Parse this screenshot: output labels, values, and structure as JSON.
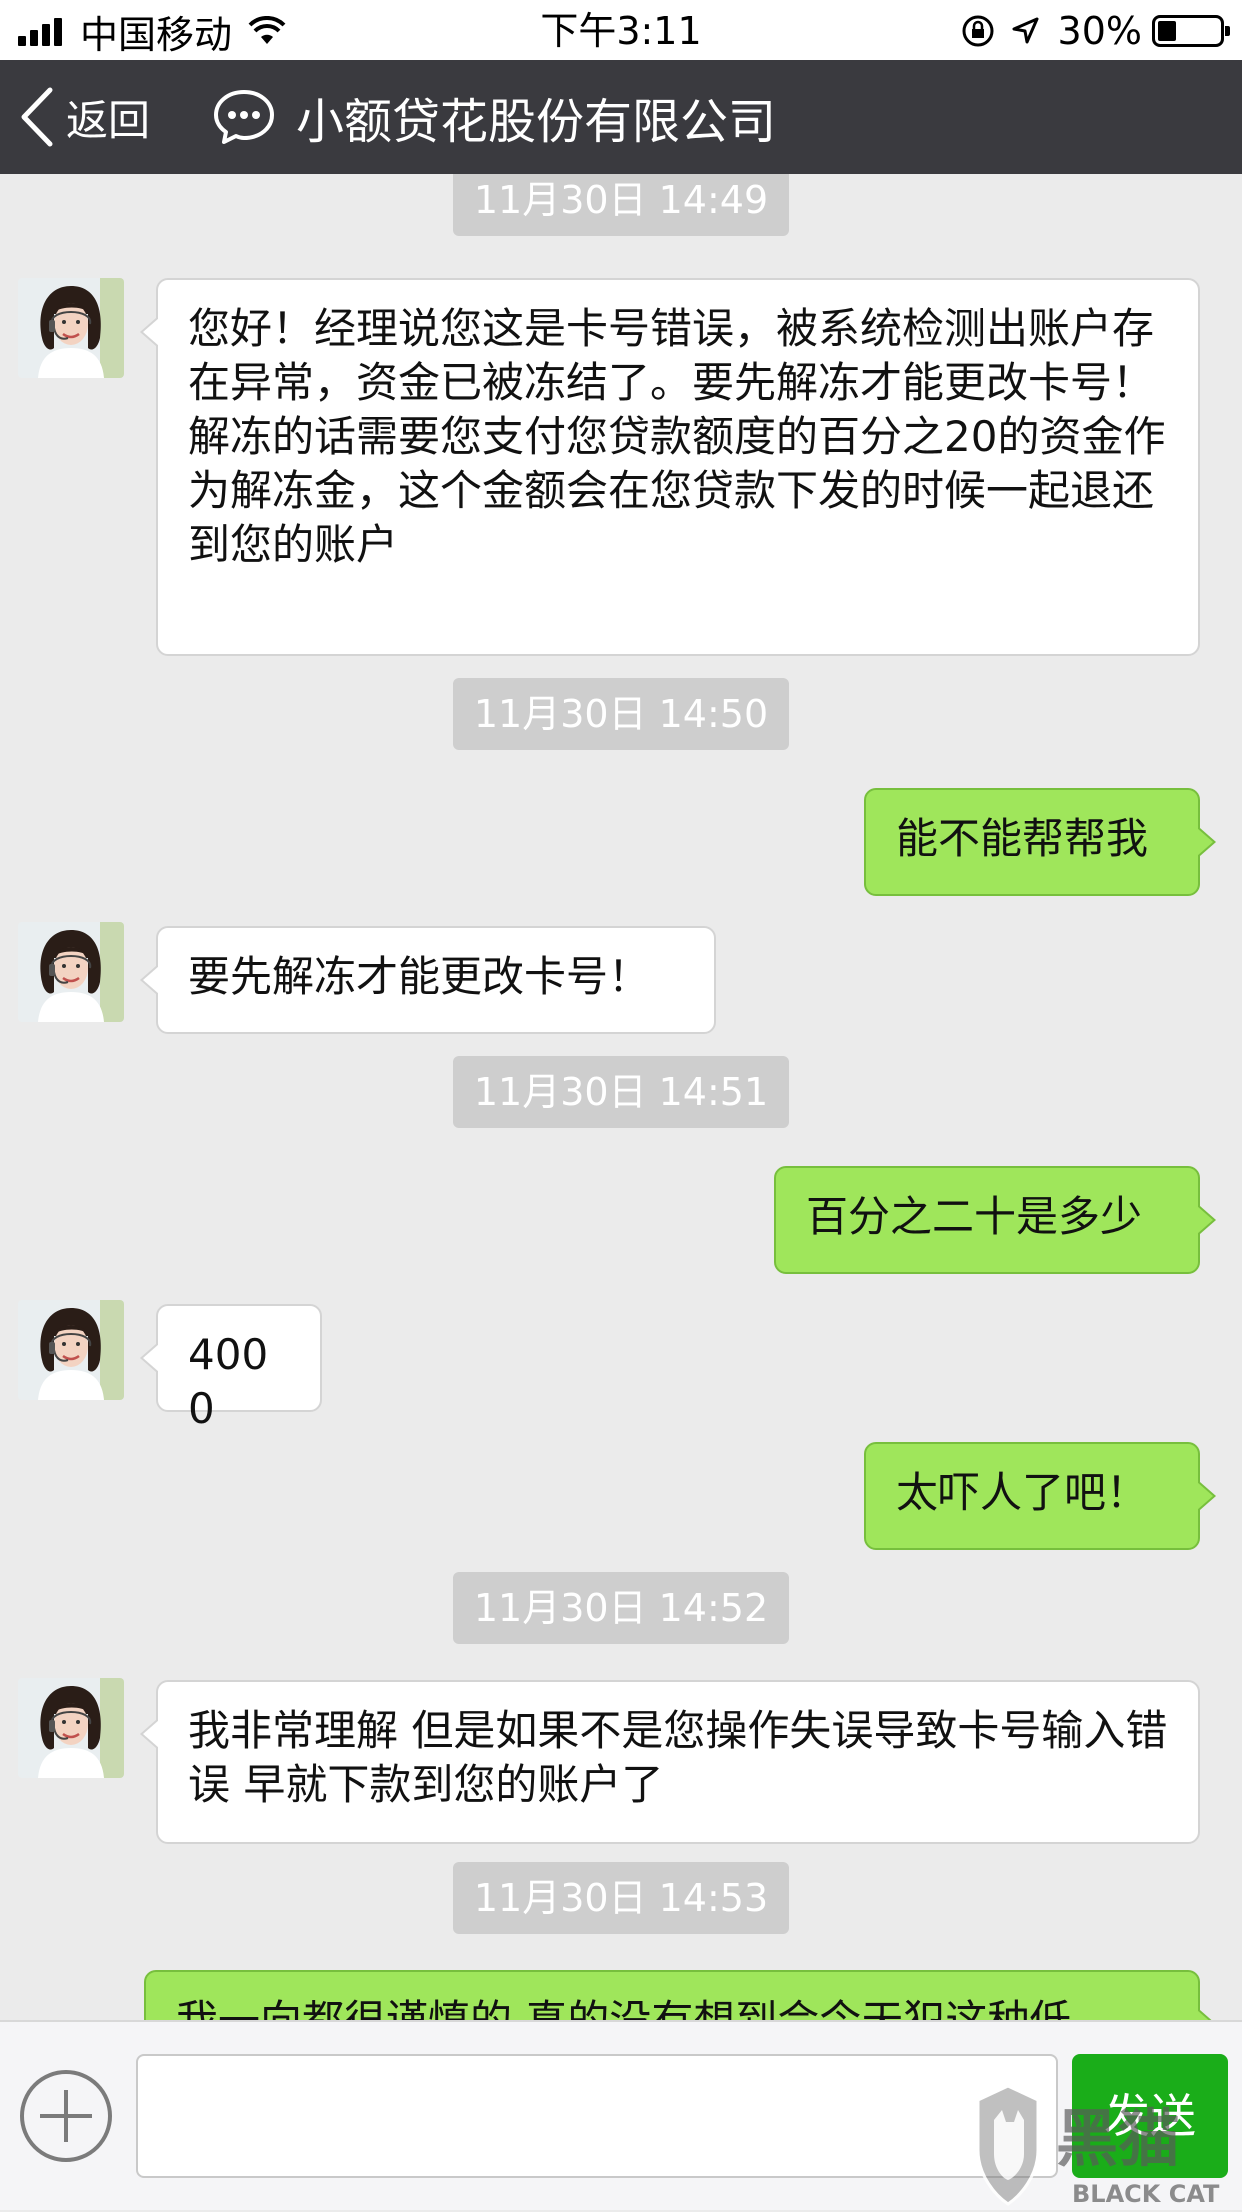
{
  "status_bar": {
    "carrier": "中国移动",
    "time": "下午3:11",
    "battery": "30%",
    "battery_level": 0.3
  },
  "nav": {
    "back_label": "返回",
    "title": "小额贷花股份有限公司",
    "icon": "chat-bubble-icon"
  },
  "messages": [
    {
      "timestamp": "11月30日 14:49"
    },
    {
      "from": "them",
      "text": "您好！经理说您这是卡号错误，被系统检测出账户存在异常，资金已被冻结了。要先解冻才能更改卡号！\n解冻的话需要您支付您贷款额度的百分之20的资金作为解冻金，这个金额会在您贷款下发的时候一起退还到您的账户"
    },
    {
      "timestamp": "11月30日 14:50"
    },
    {
      "from": "me",
      "text": "能不能帮帮我"
    },
    {
      "from": "them",
      "text": "要先解冻才能更改卡号！"
    },
    {
      "timestamp": "11月30日 14:51"
    },
    {
      "from": "me",
      "text": "百分之二十是多少"
    },
    {
      "from": "them",
      "text": "4000"
    },
    {
      "from": "me",
      "text": "太吓人了吧！"
    },
    {
      "timestamp": "11月30日 14:52"
    },
    {
      "from": "them",
      "text": "我非常理解 但是如果不是您操作失误导致卡号输入错误 早就下款到您的账户了"
    },
    {
      "timestamp": "11月30日 14:53"
    },
    {
      "from": "me",
      "text": "我一向都很谨慎的 真的没有想到会今天犯这种低"
    }
  ],
  "input": {
    "value": "",
    "send_label": "发送"
  },
  "watermark": {
    "text_cn": "黑猫",
    "text_en": "BLACK CAT"
  }
}
